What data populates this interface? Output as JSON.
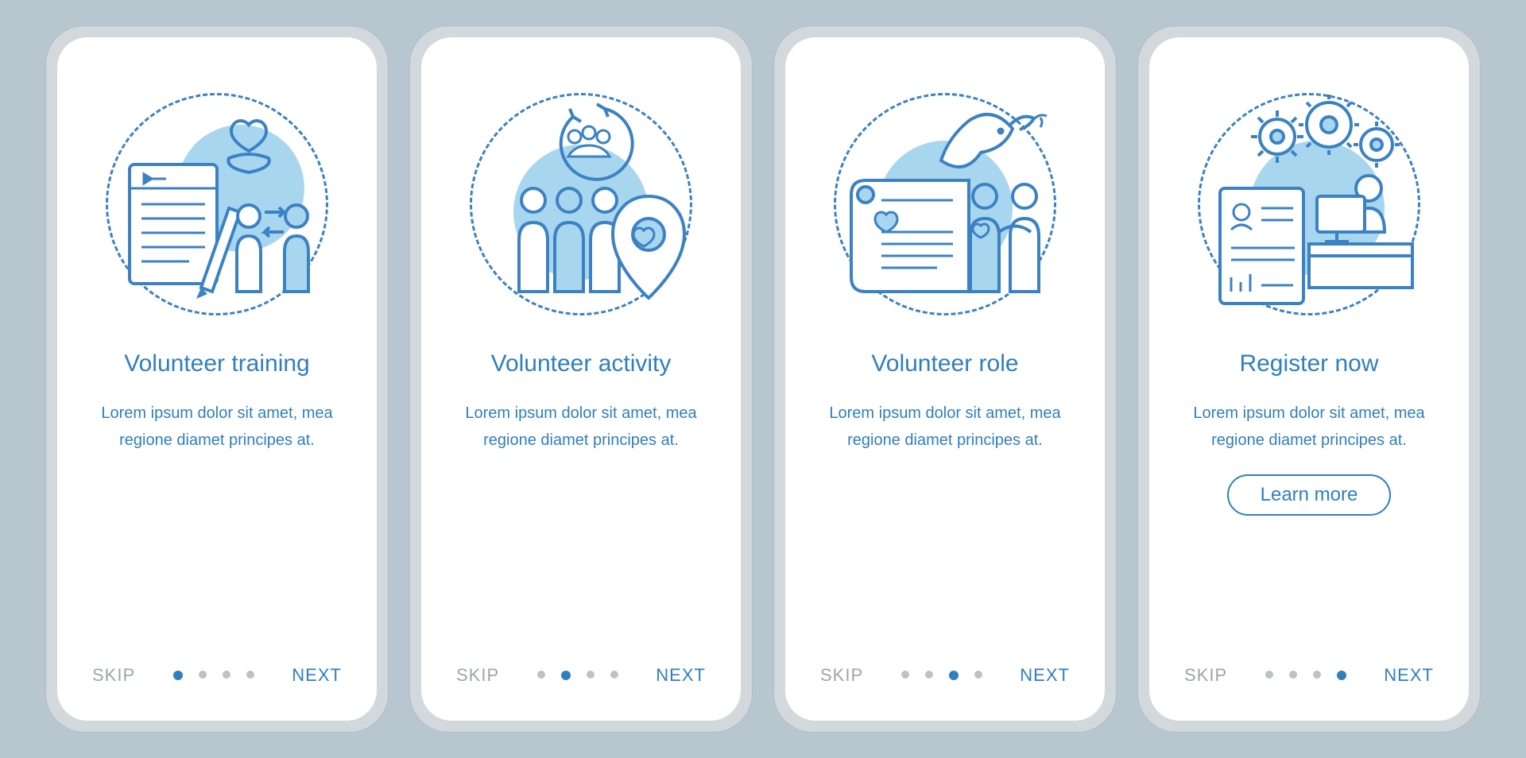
{
  "common": {
    "skip_label": "SKIP",
    "next_label": "NEXT",
    "learn_more_label": "Learn more",
    "body_text": "Lorem ipsum dolor sit amet, mea regione diamet principes at.",
    "colors": {
      "accent": "#2f7fbf",
      "muted": "#9aa6ad",
      "background": "#b7c6cf",
      "phone_frame": "#d2d8dc",
      "light_fill": "#a9d6ef"
    }
  },
  "screens": [
    {
      "title": "Volunteer training",
      "icon_name": "training-icon",
      "active_dot": 0,
      "show_learn_more": false
    },
    {
      "title": "Volunteer activity",
      "icon_name": "activity-icon",
      "active_dot": 1,
      "show_learn_more": false
    },
    {
      "title": "Volunteer role",
      "icon_name": "role-icon",
      "active_dot": 2,
      "show_learn_more": false
    },
    {
      "title": "Register now",
      "icon_name": "register-icon",
      "active_dot": 3,
      "show_learn_more": true
    }
  ]
}
